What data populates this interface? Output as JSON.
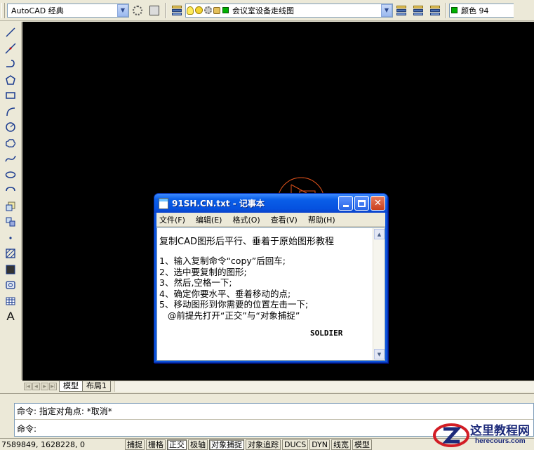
{
  "toolbar": {
    "workspace": "AutoCAD 经典",
    "layer": "会议室设备走线图",
    "color": "颜色 94"
  },
  "tabs": {
    "model": "模型",
    "layout1": "布局1"
  },
  "command": {
    "line1": "命令: 指定对角点: *取消*",
    "line2": "命令:"
  },
  "status": {
    "coords": "7589849, 1628228, 0",
    "buttons": [
      "捕捉",
      "栅格",
      "正交",
      "极轴",
      "对象捕捉",
      "对象追踪",
      "DUCS",
      "DYN",
      "线宽",
      "模型"
    ]
  },
  "notepad": {
    "title": "91SH.CN.txt - 记事本",
    "menu": [
      "文件(F)",
      "编辑(E)",
      "格式(O)",
      "查看(V)",
      "帮助(H)"
    ],
    "content": {
      "heading": "复制CAD图形后平行、垂着于原始图形教程",
      "steps": [
        "1、输入复制命令“copy”后回车;",
        "2、选中要复制的图形;",
        "3、然后,空格一下;",
        "4、确定你要水平、垂着移动的点;",
        "5、移动图形到你需要的位置左击一下;",
        "   @前提先打开“正交”与“对象捕捉”"
      ],
      "signature": "SOLDIER"
    }
  },
  "watermark": {
    "title": "这里教程网",
    "url": "herecours.com"
  },
  "colors": {
    "canvas": "#000000",
    "cad_shape": "#e0521b",
    "xp_title": "#0a52dd"
  }
}
